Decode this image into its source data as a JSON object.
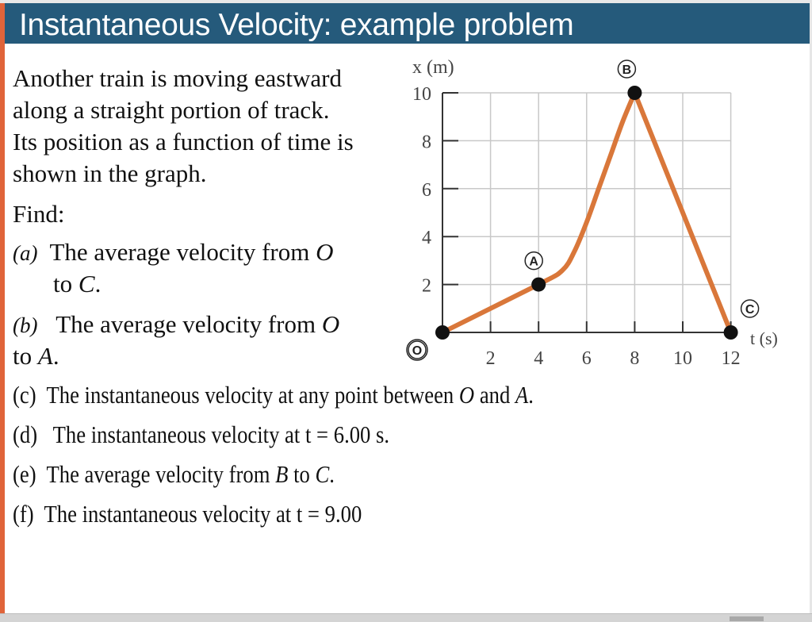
{
  "slide": {
    "title": "Instantaneous Velocity: example problem",
    "intro_lines": [
      "Another train is moving eastward",
      "along a straight portion of track.",
      "Its position as a function of time is",
      "shown in the graph."
    ],
    "find_label": "Find:",
    "questions": [
      {
        "label": "(a)",
        "text": "The average velocity from ",
        "var1": "O",
        "cont_prefix": "to ",
        "var2": "C",
        "end": "."
      },
      {
        "label": "(b)",
        "text": "The average velocity from ",
        "var1": "O",
        "cont_prefix": "to ",
        "var2": "A",
        "end": "."
      },
      {
        "label": "(c)",
        "text": "The instantaneous velocity at any point between ",
        "var1": "O",
        "mid": " and ",
        "var2": "A",
        "end": "."
      },
      {
        "label": "(d)",
        "text": "The instantaneous velocity at t = 6.00 s."
      },
      {
        "label": "(e)",
        "text": "The average velocity from ",
        "var1": "B",
        "mid": " to ",
        "var2": "C",
        "end": "."
      },
      {
        "label": "(f)",
        "text": "The instantaneous velocity at t = 9.00"
      }
    ]
  },
  "colors": {
    "title_bar": "#255a7b",
    "accent": "#e0643a",
    "curve": "#d9773a"
  },
  "chart_data": {
    "type": "line",
    "title": "",
    "xlabel": "t (s)",
    "ylabel": "x (m)",
    "xlim": [
      0,
      12
    ],
    "ylim": [
      0,
      10
    ],
    "x_ticks": [
      2,
      4,
      6,
      8,
      10,
      12
    ],
    "y_ticks": [
      2,
      4,
      6,
      8,
      10
    ],
    "grid": true,
    "series": [
      {
        "name": "position",
        "x": [
          0,
          4,
          5,
          5.5,
          6,
          6.5,
          7,
          7.5,
          8,
          12
        ],
        "y": [
          0,
          2,
          2.6,
          3.4,
          4.6,
          6.0,
          7.4,
          8.8,
          10,
          0
        ]
      }
    ],
    "points": [
      {
        "label": "O",
        "t": 0,
        "x": 0
      },
      {
        "label": "A",
        "t": 4,
        "x": 2
      },
      {
        "label": "B",
        "t": 8,
        "x": 10
      },
      {
        "label": "C",
        "t": 12,
        "x": 0
      }
    ]
  }
}
